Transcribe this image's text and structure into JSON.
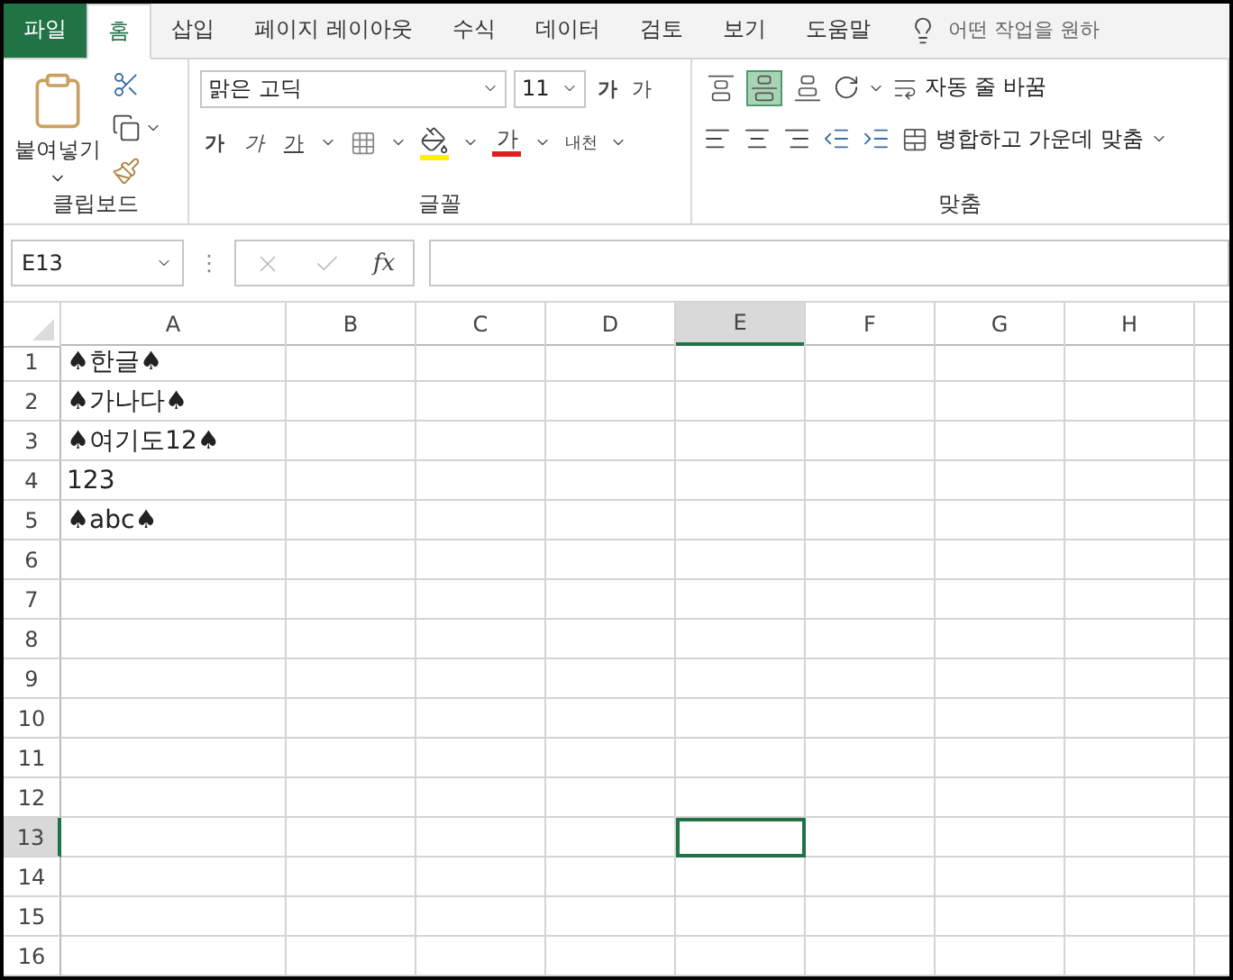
{
  "tabs": [
    {
      "label": "파일",
      "kind": "file",
      "selected": false
    },
    {
      "label": "홈",
      "kind": "tab",
      "selected": true
    },
    {
      "label": "삽입",
      "kind": "tab",
      "selected": false
    },
    {
      "label": "페이지 레이아웃",
      "kind": "tab",
      "selected": false
    },
    {
      "label": "수식",
      "kind": "tab",
      "selected": false
    },
    {
      "label": "데이터",
      "kind": "tab",
      "selected": false
    },
    {
      "label": "검토",
      "kind": "tab",
      "selected": false
    },
    {
      "label": "보기",
      "kind": "tab",
      "selected": false
    },
    {
      "label": "도움말",
      "kind": "tab",
      "selected": false
    }
  ],
  "tell_me": {
    "placeholder": "어떤 작업을 원하"
  },
  "clipboard": {
    "label": "클립보드",
    "paste_label": "붙여넣기"
  },
  "font": {
    "label": "글꼴",
    "font_name": "맑은 고딕",
    "font_size": "11",
    "grow": "가",
    "shrink": "가",
    "bold": "가",
    "italic": "가",
    "underline": "가",
    "font_color_letter": "가",
    "phonetic": "내천"
  },
  "alignment": {
    "label": "맞춤",
    "vertical": [
      {
        "kind": "top",
        "selected": false
      },
      {
        "kind": "middle",
        "selected": true
      },
      {
        "kind": "bottom",
        "selected": false
      }
    ],
    "wrap": "자동 줄 바꿈",
    "merge": "병합하고 가운데 맞춤"
  },
  "name_box": "E13",
  "bar_handle": "⋮",
  "function_label": "fx",
  "columns": [
    {
      "label": "A",
      "selected": false
    },
    {
      "label": "B",
      "selected": false
    },
    {
      "label": "C",
      "selected": false
    },
    {
      "label": "D",
      "selected": false
    },
    {
      "label": "E",
      "selected": true
    },
    {
      "label": "F",
      "selected": false
    },
    {
      "label": "G",
      "selected": false
    },
    {
      "label": "H",
      "selected": false
    }
  ],
  "rows": [
    {
      "label": "1",
      "selected": false,
      "cells": [
        "♠한글♠"
      ]
    },
    {
      "label": "2",
      "selected": false,
      "cells": [
        "♠가나다♠"
      ]
    },
    {
      "label": "3",
      "selected": false,
      "cells": [
        "♠여기도12♠"
      ]
    },
    {
      "label": "4",
      "selected": false,
      "cells": [
        "123"
      ]
    },
    {
      "label": "5",
      "selected": false,
      "cells": [
        "♠abc♠"
      ]
    },
    {
      "label": "6",
      "selected": false
    },
    {
      "label": "7",
      "selected": false
    },
    {
      "label": "8",
      "selected": false
    },
    {
      "label": "9",
      "selected": false
    },
    {
      "label": "10",
      "selected": false
    },
    {
      "label": "11",
      "selected": false
    },
    {
      "label": "12",
      "selected": false
    },
    {
      "label": "13",
      "selected": true
    },
    {
      "label": "14",
      "selected": false
    },
    {
      "label": "15",
      "selected": false
    },
    {
      "label": "16",
      "selected": false
    }
  ]
}
